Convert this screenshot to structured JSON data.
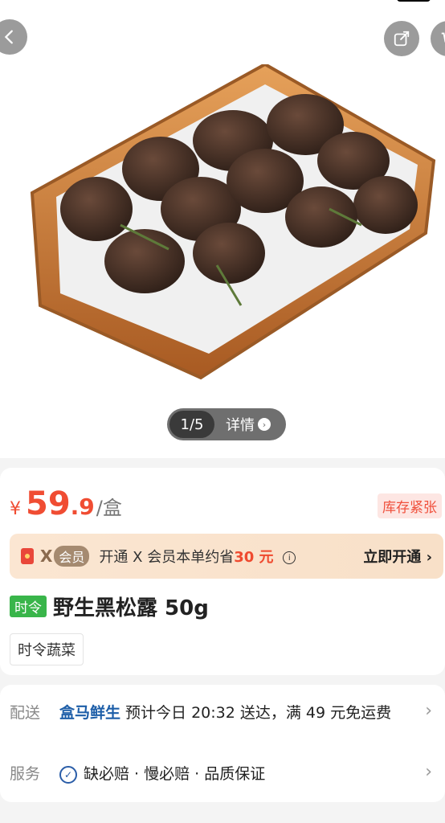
{
  "pager": {
    "count": "1/5",
    "detail": "详情"
  },
  "price": {
    "yen": "¥",
    "int": "59",
    "dec": ".9",
    "unit": "/盒",
    "stock": "库存紧张"
  },
  "vip": {
    "x": "X",
    "label": "会员",
    "text_before": "开通 X 会员本单约省",
    "save": "30 元",
    "open": "立即开通"
  },
  "title": {
    "tag": "时令",
    "name": "野生黑松露 50g",
    "category": "时令蔬菜"
  },
  "delivery": {
    "label": "配送",
    "brand": "盒马鲜生",
    "text": " 预计今日 20:32 送达，满 49 元免运费"
  },
  "service": {
    "label": "服务",
    "text": "缺必赔 · 慢必赔 · 品质保证"
  },
  "icons": [
    "back-icon",
    "share-icon",
    "cart-icon",
    "info-icon",
    "chevron-right-icon",
    "check-circle-icon"
  ]
}
